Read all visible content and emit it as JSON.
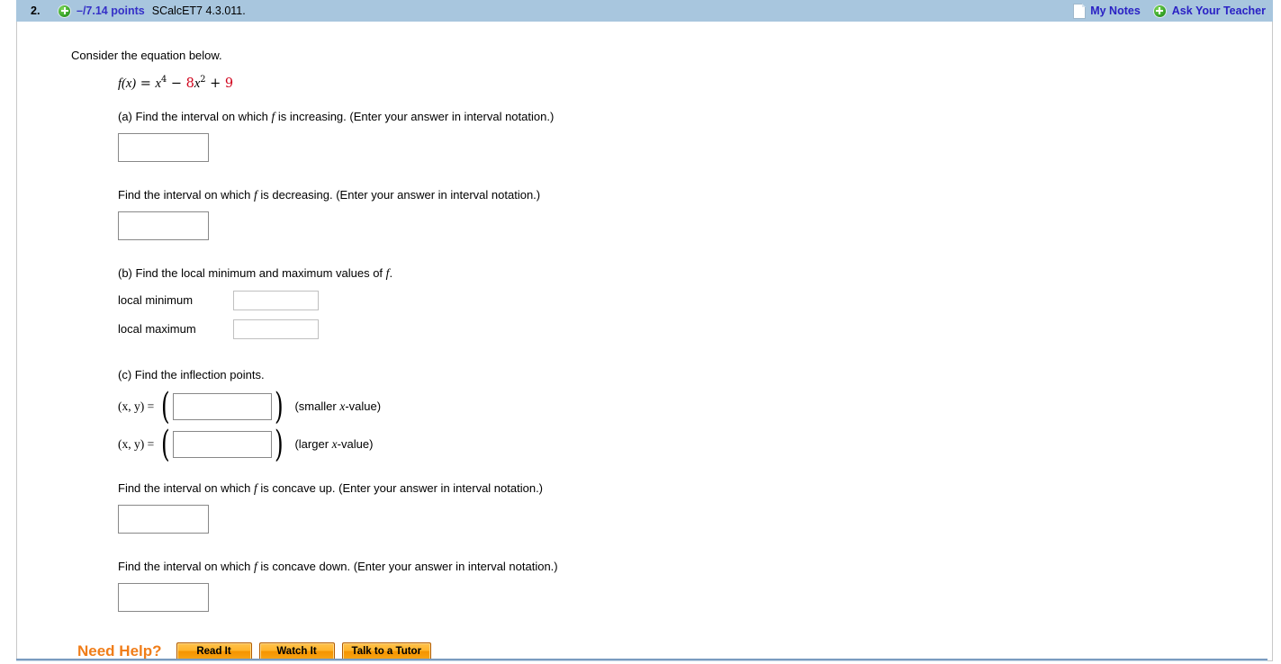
{
  "header": {
    "question_number": "2.",
    "expand_icon": "plus-circle-icon",
    "points": "–/7.14 points",
    "question_key": "SCalcET7 4.3.011.",
    "notes_icon": "document-icon",
    "my_notes_label": "My Notes",
    "ask_plus_icon": "plus-circle-icon",
    "ask_teacher_label": "Ask Your Teacher",
    "bar_color": "#a8c6de",
    "link_color": "#2a21c4",
    "points_color": "#3530c7"
  },
  "body": {
    "prompt": "Consider the equation below.",
    "equation": {
      "fx": "f(x)",
      "equals": "=",
      "term1_base": "x",
      "term1_exp": "4",
      "minus": "−",
      "term2_coef": "8",
      "term2_base": "x",
      "term2_exp": "2",
      "plus": "+",
      "term3": "9",
      "red_color": "#d0021b"
    },
    "part_a": {
      "increasing_question_prefix": "(a) Find the interval on which ",
      "increasing_var": "f",
      "increasing_question_suffix": " is increasing. (Enter your answer in interval notation.)",
      "increasing_value": "",
      "decreasing_question_prefix": "Find the interval on which ",
      "decreasing_var": "f",
      "decreasing_question_suffix": " is decreasing. (Enter your answer in interval notation.)",
      "decreasing_value": ""
    },
    "part_b": {
      "question_prefix": "(b) Find the local minimum and maximum values of ",
      "question_var": "f",
      "question_suffix": ".",
      "local_minimum_label": "local minimum",
      "local_minimum_value": "",
      "local_maximum_label": "local maximum",
      "local_maximum_value": ""
    },
    "part_c": {
      "question": "(c) Find the inflection points.",
      "row1_label_pre": "(x, y)",
      "row1_label_eq": " = ",
      "row1_value": "",
      "row1_note_pre": "(smaller ",
      "row1_note_var": "x",
      "row1_note_post": "-value)",
      "row2_label_pre": "(x, y)",
      "row2_label_eq": " = ",
      "row2_value": "",
      "row2_note_pre": "(larger ",
      "row2_note_var": "x",
      "row2_note_post": "-value)",
      "open_paren": "(",
      "close_paren": ")"
    },
    "concavity": {
      "up_question_prefix": "Find the interval on which ",
      "up_var": "f",
      "up_question_suffix": " is concave up. (Enter your answer in interval notation.)",
      "up_value": "",
      "down_question_prefix": "Find the interval on which ",
      "down_var": "f",
      "down_question_suffix": " is concave down. (Enter your answer in interval notation.)",
      "down_value": ""
    },
    "need_help": {
      "label": "Need Help?",
      "label_color": "#f07d19",
      "buttons": [
        {
          "label": "Read It"
        },
        {
          "label": "Watch It"
        },
        {
          "label": "Talk to a Tutor"
        }
      ]
    }
  }
}
